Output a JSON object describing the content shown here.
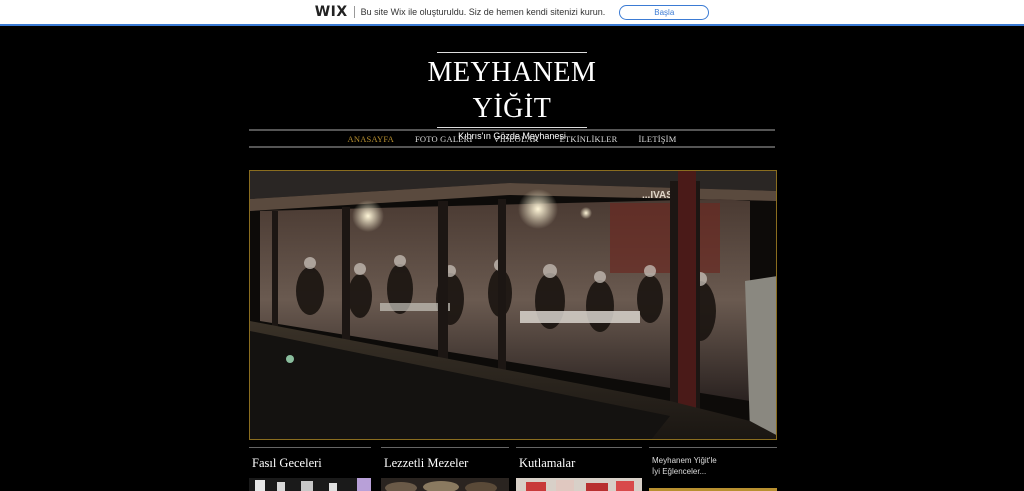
{
  "wix_banner": {
    "logo": "WIX",
    "message": "Bu site Wix ile oluşturuldu. Siz de hemen kendi sitenizi kurun.",
    "button": "Başla"
  },
  "header": {
    "title": "MEYHANEM YİĞİT",
    "subtitle": "Kıbrıs'ın Gözde Meyhanesi"
  },
  "nav": {
    "items": [
      {
        "label": "ANASAYFA",
        "active": true
      },
      {
        "label": "FOTO GALERİ",
        "active": false
      },
      {
        "label": "VİDEOLAR",
        "active": false
      },
      {
        "label": "ETKİNLİKLER",
        "active": false
      },
      {
        "label": "İLETİŞİM",
        "active": false
      }
    ]
  },
  "hero": {
    "sign_text": "...IVAS"
  },
  "cards": [
    {
      "title": "Fasıl Geceleri"
    },
    {
      "title": "Lezzetli Mezeler"
    },
    {
      "title": "Kutlamalar"
    },
    {
      "text_line1": "Meyhanem Yiğit'le",
      "text_line2": "İyi Eğlenceler..."
    }
  ],
  "colors": {
    "accent": "#b89030",
    "wix_blue": "#3b7bd4",
    "background": "#000000"
  }
}
